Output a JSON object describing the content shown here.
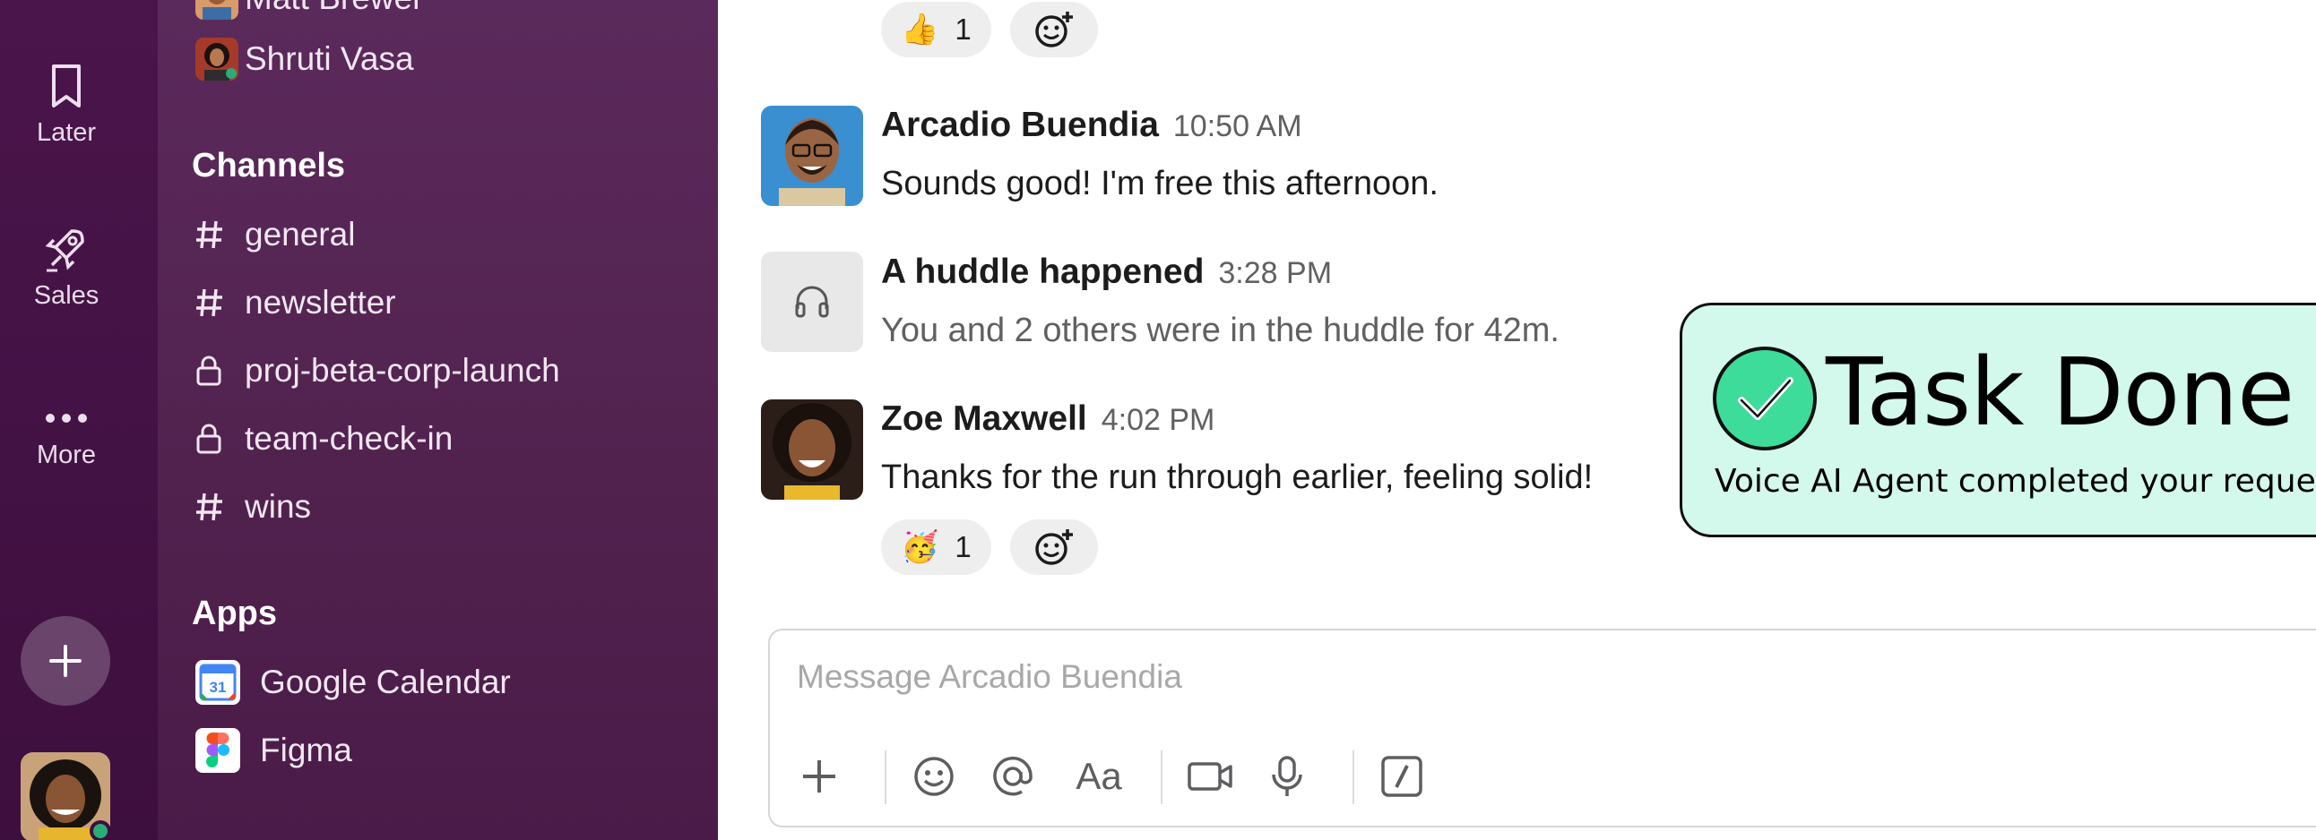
{
  "rail": {
    "items": [
      {
        "label": "Later",
        "icon": "bookmark-icon"
      },
      {
        "label": "Sales",
        "icon": "rocket-icon"
      },
      {
        "label": "More",
        "icon": "ellipsis-icon"
      }
    ],
    "add_icon": "plus-icon",
    "user_avatar": "avatar"
  },
  "sidebar": {
    "dms": [
      {
        "name": "Matt Brewer"
      },
      {
        "name": "Shruti Vasa"
      }
    ],
    "channels_heading": "Channels",
    "channels": [
      {
        "name": "general",
        "icon": "hash-icon"
      },
      {
        "name": "newsletter",
        "icon": "hash-icon"
      },
      {
        "name": "proj-beta-corp-launch",
        "icon": "lock-icon"
      },
      {
        "name": "team-check-in",
        "icon": "lock-icon"
      },
      {
        "name": "wins",
        "icon": "hash-icon"
      }
    ],
    "apps_heading": "Apps",
    "apps": [
      {
        "name": "Google Calendar",
        "icon": "google-calendar-icon",
        "badge": "31"
      },
      {
        "name": "Figma",
        "icon": "figma-icon"
      }
    ]
  },
  "main": {
    "top_reaction": {
      "emoji": "👍",
      "count": "1"
    },
    "messages": [
      {
        "author": "Arcadio Buendia",
        "time": "10:50 AM",
        "text": "Sounds good! I'm free this afternoon."
      },
      {
        "author": "A huddle happened",
        "time": "3:28 PM",
        "text": "You and 2 others were in the huddle for 42m."
      },
      {
        "author": "Zoe Maxwell",
        "time": "4:02 PM",
        "text": "Thanks for the run through earlier, feeling solid!"
      }
    ],
    "bottom_reaction": {
      "emoji": "🥳",
      "count": "1"
    },
    "composer": {
      "placeholder": "Message Arcadio Buendia",
      "tools": [
        "plus-icon",
        "emoji-icon",
        "mention-icon",
        "format-icon",
        "video-icon",
        "microphone-icon",
        "slash-command-icon"
      ],
      "format_label": "Aa"
    }
  },
  "overlay": {
    "title": "Task Done",
    "subtitle": "Voice AI Agent completed your request",
    "accent": "#3ddc9a",
    "background": "#d3f8ec"
  },
  "colors": {
    "rail": "#3f0e40",
    "sidebar": "#52224f",
    "presence": "#2bac76"
  }
}
